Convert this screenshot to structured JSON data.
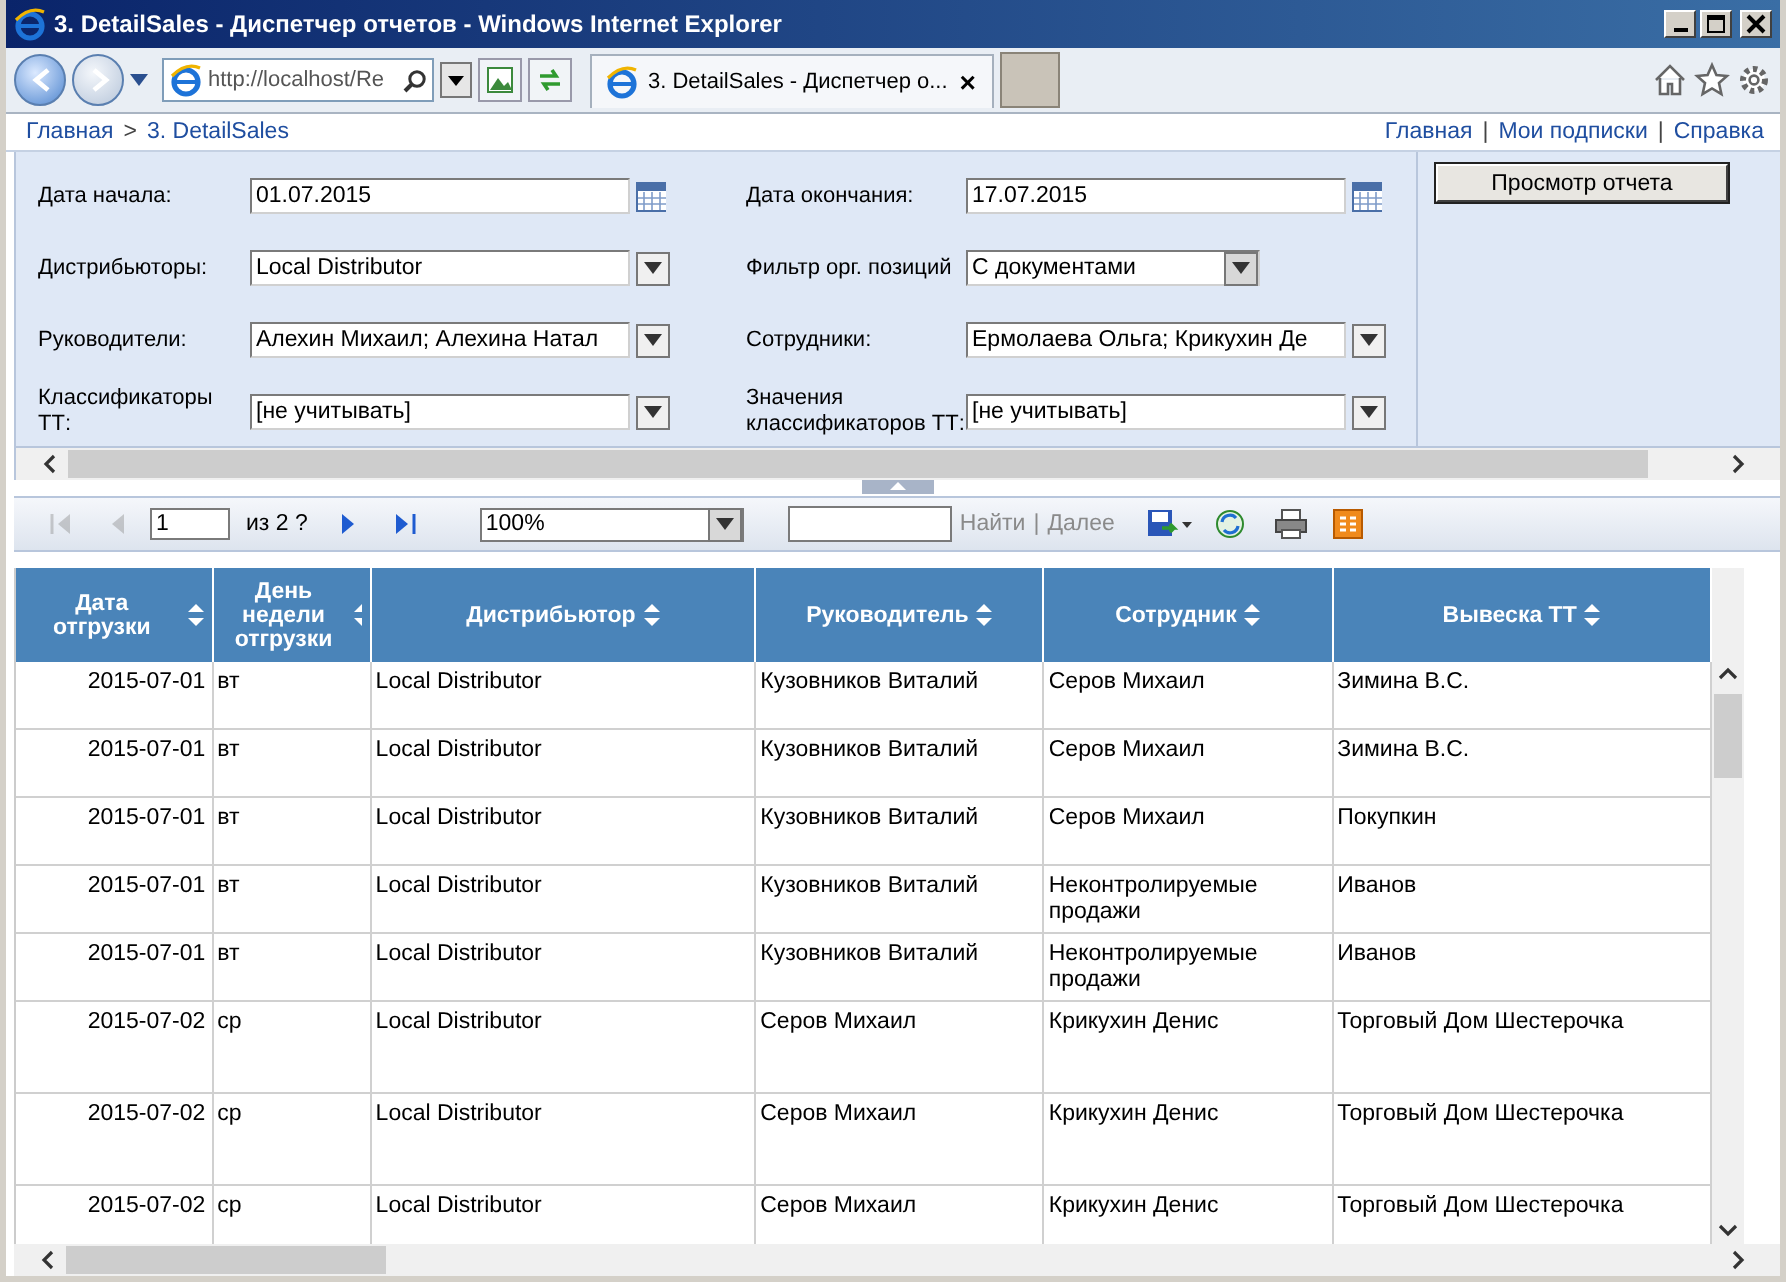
{
  "window": {
    "title": "3. DetailSales - Диспетчер отчетов - Windows Internet Explorer"
  },
  "browser": {
    "address": "http://localhost/Re",
    "tab": {
      "label": "3. DetailSales - Диспетчер о...",
      "close": "×"
    }
  },
  "breadcrumb": {
    "items": [
      "Главная",
      "3. DetailSales"
    ],
    "separator": ">"
  },
  "header_links": {
    "items": [
      "Главная",
      "Мои подписки",
      "Справка"
    ],
    "separator": "|"
  },
  "parameters": [
    {
      "label": "Дата начала:",
      "value": "01.07.2015",
      "kind": "date"
    },
    {
      "label": "Дата окончания:",
      "value": "17.07.2015",
      "kind": "date"
    },
    {
      "label": "Дистрибьюторы:",
      "value": "Local Distributor",
      "kind": "multi"
    },
    {
      "label": "Фильтр орг. позиций",
      "value": "С документами",
      "kind": "select"
    },
    {
      "label": "Руководители:",
      "value": "Алехин Михаил; Алехина Натал",
      "kind": "multi"
    },
    {
      "label": "Сотрудники:",
      "value": "Ермолаева Ольга; Крикухин Де",
      "kind": "multi"
    },
    {
      "label": "Классификаторы ТТ:",
      "value": "[не учитывать]",
      "kind": "multi"
    },
    {
      "label": "Значения классификаторов ТТ:",
      "value": "[не учитывать]",
      "kind": "multi"
    }
  ],
  "view_button": "Просмотр отчета",
  "toolbar": {
    "nav": [
      {
        "kind": "first",
        "disabled": true
      },
      {
        "kind": "prev",
        "disabled": true
      },
      {
        "kind": "next",
        "disabled": false
      },
      {
        "kind": "last",
        "disabled": false
      }
    ],
    "page": "1",
    "page_count": "из 2 ?",
    "zoom": "100%",
    "find": "Найти",
    "separator": "|",
    "find_next": "Далее"
  },
  "table": {
    "columns": [
      "Дата отгрузки",
      "День недели отгрузки",
      "Дистрибьютор",
      "Руководитель",
      "Сотрудник",
      "Вывеска ТТ"
    ],
    "rows": [
      [
        "2015-07-01",
        "вт",
        "Local Distributor",
        "Кузовников Виталий",
        "Серов Михаил",
        "Зимина В.С."
      ],
      [
        "2015-07-01",
        "вт",
        "Local Distributor",
        "Кузовников Виталий",
        "Серов Михаил",
        "Зимина В.С."
      ],
      [
        "2015-07-01",
        "вт",
        "Local Distributor",
        "Кузовников Виталий",
        "Серов Михаил",
        "Покупкин"
      ],
      [
        "2015-07-01",
        "вт",
        "Local Distributor",
        "Кузовников Виталий",
        "Неконтролируемые продажи",
        "Иванов"
      ],
      [
        "2015-07-01",
        "вт",
        "Local Distributor",
        "Кузовников Виталий",
        "Неконтролируемые продажи",
        "Иванов"
      ],
      [
        "2015-07-02",
        "ср",
        "Local Distributor",
        "Серов Михаил",
        "Крикухин Денис",
        "Торговый Дом Шестерочка"
      ],
      [
        "2015-07-02",
        "ср",
        "Local Distributor",
        "Серов Михаил",
        "Крикухин Денис",
        "Торговый Дом Шестерочка"
      ],
      [
        "2015-07-02",
        "ср",
        "Local Distributor",
        "Серов Михаил",
        "Крикухин Денис",
        "Торговый Дом Шестерочка"
      ]
    ]
  }
}
